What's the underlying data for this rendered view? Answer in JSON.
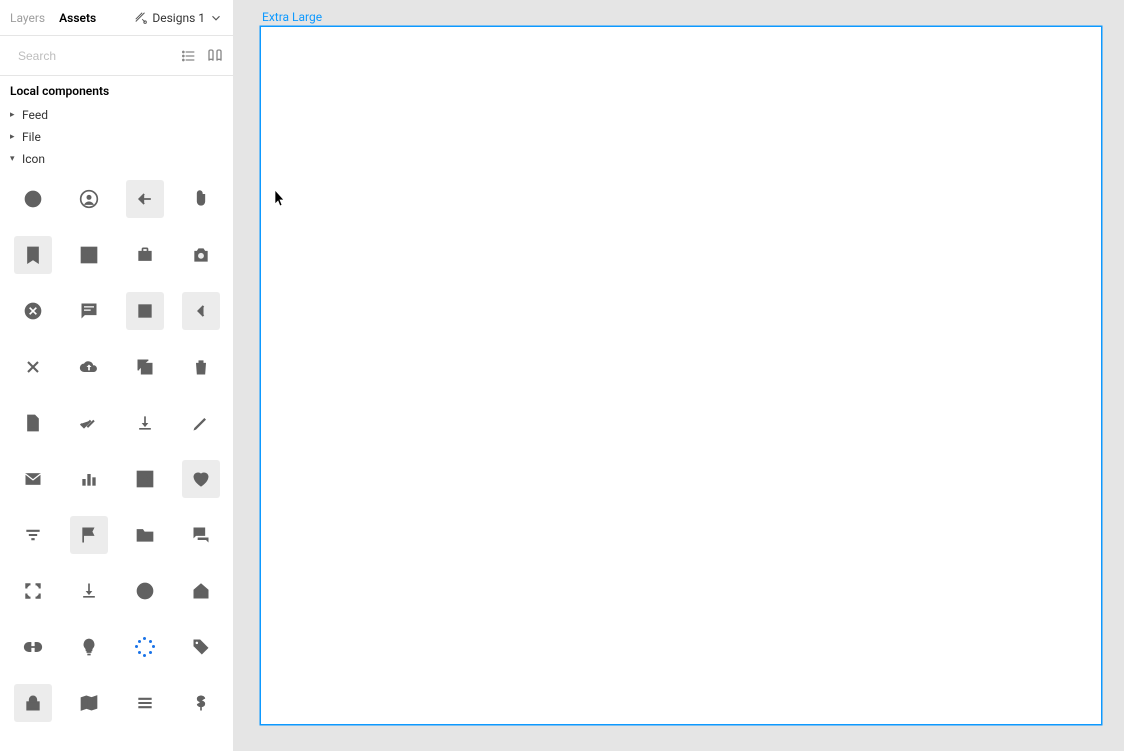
{
  "tabs": {
    "layers": "Layers",
    "assets": "Assets"
  },
  "page_selector": {
    "label": "Designs 1"
  },
  "search": {
    "placeholder": "Search"
  },
  "section_header": "Local components",
  "tree": {
    "feed": "Feed",
    "file": "File",
    "icon": "Icon"
  },
  "frame": {
    "label": "Extra Large"
  },
  "icons": [
    {
      "name": "clock-icon",
      "shaded": false
    },
    {
      "name": "account-circle-icon",
      "shaded": false
    },
    {
      "name": "arrow-back-icon",
      "shaded": true
    },
    {
      "name": "attachment-icon",
      "shaded": false
    },
    {
      "name": "bookmark-icon",
      "shaded": true
    },
    {
      "name": "grid-view-icon",
      "shaded": false
    },
    {
      "name": "briefcase-icon",
      "shaded": false
    },
    {
      "name": "camera-icon",
      "shaded": false
    },
    {
      "name": "cancel-icon",
      "shaded": false
    },
    {
      "name": "chat-icon",
      "shaded": false
    },
    {
      "name": "checkbox-outline-icon",
      "shaded": true
    },
    {
      "name": "chevron-left-icon",
      "shaded": true
    },
    {
      "name": "close-icon",
      "shaded": false
    },
    {
      "name": "cloud-upload-icon",
      "shaded": false
    },
    {
      "name": "copy-icon",
      "shaded": false
    },
    {
      "name": "delete-icon",
      "shaded": false
    },
    {
      "name": "description-icon",
      "shaded": false
    },
    {
      "name": "done-all-icon",
      "shaded": false
    },
    {
      "name": "download-icon",
      "shaded": false
    },
    {
      "name": "edit-icon",
      "shaded": false
    },
    {
      "name": "email-icon",
      "shaded": false
    },
    {
      "name": "bar-chart-icon",
      "shaded": false
    },
    {
      "name": "exit-to-app-icon",
      "shaded": false
    },
    {
      "name": "favorite-icon",
      "shaded": true
    },
    {
      "name": "filter-list-icon",
      "shaded": false
    },
    {
      "name": "flag-icon",
      "shaded": true
    },
    {
      "name": "folder-icon",
      "shaded": false
    },
    {
      "name": "forum-icon",
      "shaded": false
    },
    {
      "name": "fullscreen-icon",
      "shaded": false
    },
    {
      "name": "get-app-icon",
      "shaded": false
    },
    {
      "name": "help-icon",
      "shaded": false
    },
    {
      "name": "home-icon",
      "shaded": false
    },
    {
      "name": "link-icon",
      "shaded": false
    },
    {
      "name": "lightbulb-icon",
      "shaded": false
    },
    {
      "name": "loading-icon",
      "shaded": false
    },
    {
      "name": "tag-icon",
      "shaded": false
    },
    {
      "name": "lock-icon",
      "shaded": true
    },
    {
      "name": "map-icon",
      "shaded": false
    },
    {
      "name": "menu-icon",
      "shaded": false
    },
    {
      "name": "dollar-icon",
      "shaded": false
    }
  ]
}
